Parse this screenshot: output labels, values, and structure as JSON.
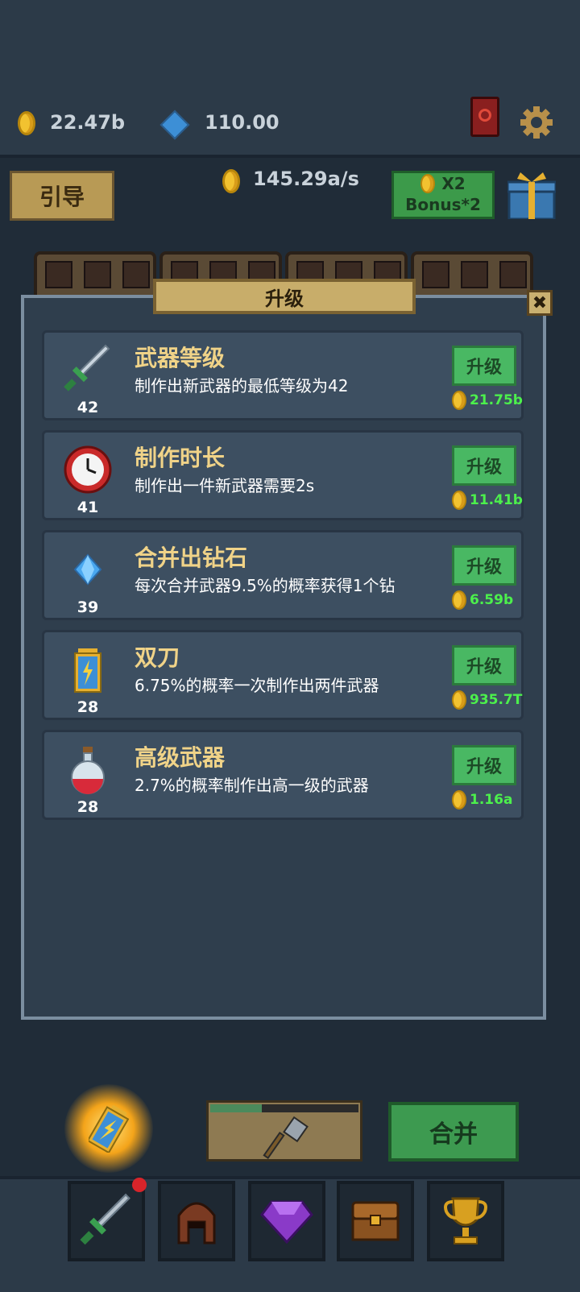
{
  "header": {
    "gold": "22.47b",
    "diamonds": "110.00",
    "income_rate": "145.29a/s",
    "guide_label": "引导",
    "bonus_line1": "X2",
    "bonus_line2": "Bonus*2"
  },
  "panel": {
    "title": "升级",
    "close_symbol": "✖",
    "upgrades": [
      {
        "title": "武器等级",
        "desc": "制作出新武器的最低等级为42",
        "level": "42",
        "button": "升级",
        "cost": "21.75b",
        "icon": "sword-icon"
      },
      {
        "title": "制作时长",
        "desc": "制作出一件新武器需要2s",
        "level": "41",
        "button": "升级",
        "cost": "11.41b",
        "icon": "clock-icon"
      },
      {
        "title": "合并出钻石",
        "desc": "每次合并武器9.5%的概率获得1个钻",
        "level": "39",
        "button": "升级",
        "cost": "6.59b",
        "icon": "diamond-icon"
      },
      {
        "title": "双刀",
        "desc": "6.75%的概率一次制作出两件武器",
        "level": "28",
        "button": "升级",
        "cost": "935.7T",
        "icon": "battery-icon"
      },
      {
        "title": "高级武器",
        "desc": "2.7%的概率制作出高一级的武器",
        "level": "28",
        "button": "升级",
        "cost": "1.16a",
        "icon": "potion-icon"
      }
    ]
  },
  "bottom": {
    "merge_label": "合并",
    "craft_progress": 0.35
  },
  "nav": [
    "sword-icon",
    "helmet-icon",
    "gem-icon",
    "chest-icon",
    "trophy-icon"
  ],
  "colors": {
    "cost_green": "#4cf04c",
    "title_gold": "#f0d388",
    "upgrade_button": "#49b863"
  }
}
